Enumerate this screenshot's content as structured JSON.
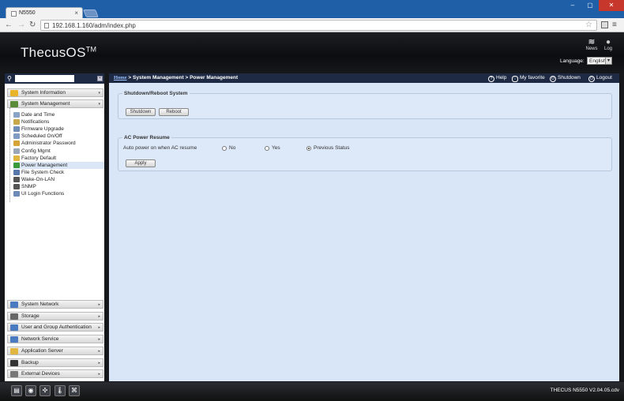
{
  "browser": {
    "tab_title": "N5550",
    "url": "192.168.1.160/adm/index.php"
  },
  "header": {
    "logo": "ThecusOS",
    "logo_tm": "TM",
    "news": "News",
    "log": "Log",
    "language_label": "Language:",
    "language_value": "English"
  },
  "sidebar": {
    "sections_top": [
      {
        "label": "System Information",
        "color": "#e8b52a"
      },
      {
        "label": "System Management",
        "color": "#5a8c3a"
      }
    ],
    "items": [
      {
        "label": "Date and Time",
        "color": "#8aa4c8"
      },
      {
        "label": "Notifications",
        "color": "#c9a84b"
      },
      {
        "label": "Firmware Upgrade",
        "color": "#6f8fb8"
      },
      {
        "label": "Scheduled On/Off",
        "color": "#7e9cc4"
      },
      {
        "label": "Administrator Password",
        "color": "#d4a437"
      },
      {
        "label": "Config Mgmt",
        "color": "#9aa7b8"
      },
      {
        "label": "Factory Default",
        "color": "#e0b640"
      },
      {
        "label": "Power Management",
        "color": "#3a9a3a"
      },
      {
        "label": "File System Check",
        "color": "#5577aa"
      },
      {
        "label": "Wake-On-LAN",
        "color": "#555555"
      },
      {
        "label": "SNMP",
        "color": "#555555"
      },
      {
        "label": "UI Login Functions",
        "color": "#6d8ab8"
      }
    ],
    "selected_item": "Power Management",
    "sections_bottom": [
      {
        "label": "System Network",
        "color": "#4a7abf"
      },
      {
        "label": "Storage",
        "color": "#666666"
      },
      {
        "label": "User and Group Authentication",
        "color": "#4a7abf"
      },
      {
        "label": "Network Service",
        "color": "#4a7abf"
      },
      {
        "label": "Application Server",
        "color": "#e0b640"
      },
      {
        "label": "Backup",
        "color": "#333333"
      },
      {
        "label": "External Devices",
        "color": "#777777"
      }
    ]
  },
  "topbar": {
    "home": "Home",
    "crumb_rest": " > System Management > Power Management",
    "help": "Help",
    "favorite": "My favorite",
    "shutdown": "Shutdown",
    "logout": "Logout"
  },
  "shutdown_section": {
    "title": "Shutdown/Reboot System",
    "shutdown_btn": "Shutdown",
    "reboot_btn": "Reboot"
  },
  "power_resume": {
    "title": "AC Power Resume",
    "label": "Auto power on when AC resume",
    "options": [
      "No",
      "Yes",
      "Previous Status"
    ],
    "selected": "Previous Status",
    "apply_btn": "Apply"
  },
  "footer": {
    "version": "THECUS N5550 V2.04.05.cdv"
  }
}
